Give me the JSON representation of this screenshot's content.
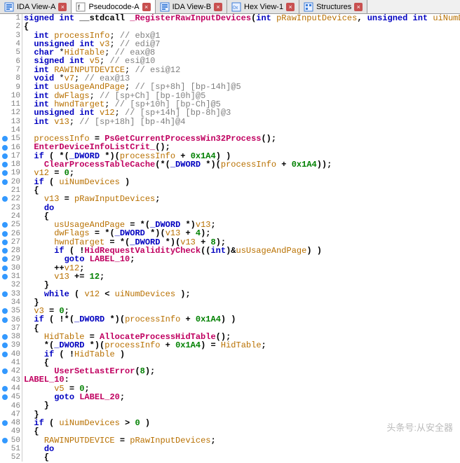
{
  "tabs": [
    {
      "label": "IDA View-A",
      "icon": "ida-icon"
    },
    {
      "label": "Pseudocode-A",
      "icon": "pseudo-icon"
    },
    {
      "label": "IDA View-B",
      "icon": "ida-icon"
    },
    {
      "label": "Hex View-1",
      "icon": "hex-icon"
    },
    {
      "label": "Structures",
      "icon": "struct-icon"
    }
  ],
  "active_tab": 1,
  "watermark": "头条号:从安全器",
  "lines": [
    {
      "n": 1,
      "bp": false,
      "tokens": [
        {
          "t": "signed",
          "c": "kw"
        },
        {
          "t": " "
        },
        {
          "t": "int",
          "c": "kw"
        },
        {
          "t": " __stdcall ",
          "c": "bld"
        },
        {
          "t": "_RegisterRawInputDevices",
          "c": "fn"
        },
        {
          "t": "(",
          "c": "bld"
        },
        {
          "t": "int",
          "c": "kw"
        },
        {
          "t": " "
        },
        {
          "t": "pRawInputDevices",
          "c": "var"
        },
        {
          "t": ", ",
          "c": "bld"
        },
        {
          "t": "unsigned",
          "c": "kw"
        },
        {
          "t": " "
        },
        {
          "t": "int",
          "c": "kw"
        },
        {
          "t": " "
        },
        {
          "t": "uiNumDevices",
          "c": "var"
        },
        {
          "t": ")",
          "c": "bld"
        }
      ]
    },
    {
      "n": 2,
      "bp": false,
      "tokens": [
        {
          "t": "{",
          "c": "bld"
        }
      ]
    },
    {
      "n": 3,
      "bp": false,
      "tokens": [
        {
          "t": "  "
        },
        {
          "t": "int",
          "c": "kw"
        },
        {
          "t": " "
        },
        {
          "t": "processInfo",
          "c": "var"
        },
        {
          "t": "; "
        },
        {
          "t": "// ebx@1",
          "c": "cm"
        }
      ]
    },
    {
      "n": 4,
      "bp": false,
      "tokens": [
        {
          "t": "  "
        },
        {
          "t": "unsigned",
          "c": "kw"
        },
        {
          "t": " "
        },
        {
          "t": "int",
          "c": "kw"
        },
        {
          "t": " "
        },
        {
          "t": "v3",
          "c": "var"
        },
        {
          "t": "; "
        },
        {
          "t": "// edi@7",
          "c": "cm"
        }
      ]
    },
    {
      "n": 5,
      "bp": false,
      "tokens": [
        {
          "t": "  "
        },
        {
          "t": "char",
          "c": "kw"
        },
        {
          "t": " *"
        },
        {
          "t": "HidTable",
          "c": "var"
        },
        {
          "t": "; "
        },
        {
          "t": "// eax@8",
          "c": "cm"
        }
      ]
    },
    {
      "n": 6,
      "bp": false,
      "tokens": [
        {
          "t": "  "
        },
        {
          "t": "signed",
          "c": "kw"
        },
        {
          "t": " "
        },
        {
          "t": "int",
          "c": "kw"
        },
        {
          "t": " "
        },
        {
          "t": "v5",
          "c": "var"
        },
        {
          "t": "; "
        },
        {
          "t": "// esi@10",
          "c": "cm"
        }
      ]
    },
    {
      "n": 7,
      "bp": false,
      "tokens": [
        {
          "t": "  "
        },
        {
          "t": "int",
          "c": "kw"
        },
        {
          "t": " "
        },
        {
          "t": "RAWINPUTDEVICE",
          "c": "var"
        },
        {
          "t": "; "
        },
        {
          "t": "// esi@12",
          "c": "cm"
        }
      ]
    },
    {
      "n": 8,
      "bp": false,
      "tokens": [
        {
          "t": "  "
        },
        {
          "t": "void",
          "c": "kw"
        },
        {
          "t": " *"
        },
        {
          "t": "v7",
          "c": "var"
        },
        {
          "t": "; "
        },
        {
          "t": "// eax@13",
          "c": "cm"
        }
      ]
    },
    {
      "n": 9,
      "bp": false,
      "tokens": [
        {
          "t": "  "
        },
        {
          "t": "int",
          "c": "kw"
        },
        {
          "t": " "
        },
        {
          "t": "usUsageAndPage",
          "c": "var"
        },
        {
          "t": "; "
        },
        {
          "t": "// [sp+8h] [bp-14h]@5",
          "c": "cm"
        }
      ]
    },
    {
      "n": 10,
      "bp": false,
      "tokens": [
        {
          "t": "  "
        },
        {
          "t": "int",
          "c": "kw"
        },
        {
          "t": " "
        },
        {
          "t": "dwFlags",
          "c": "var"
        },
        {
          "t": "; "
        },
        {
          "t": "// [sp+Ch] [bp-10h]@5",
          "c": "cm"
        }
      ]
    },
    {
      "n": 11,
      "bp": false,
      "tokens": [
        {
          "t": "  "
        },
        {
          "t": "int",
          "c": "kw"
        },
        {
          "t": " "
        },
        {
          "t": "hwndTarget",
          "c": "var"
        },
        {
          "t": "; "
        },
        {
          "t": "// [sp+10h] [bp-Ch]@5",
          "c": "cm"
        }
      ]
    },
    {
      "n": 12,
      "bp": false,
      "tokens": [
        {
          "t": "  "
        },
        {
          "t": "unsigned",
          "c": "kw"
        },
        {
          "t": " "
        },
        {
          "t": "int",
          "c": "kw"
        },
        {
          "t": " "
        },
        {
          "t": "v12",
          "c": "var"
        },
        {
          "t": "; "
        },
        {
          "t": "// [sp+14h] [bp-8h]@3",
          "c": "cm"
        }
      ]
    },
    {
      "n": 13,
      "bp": false,
      "tokens": [
        {
          "t": "  "
        },
        {
          "t": "int",
          "c": "kw"
        },
        {
          "t": " "
        },
        {
          "t": "v13",
          "c": "var"
        },
        {
          "t": "; "
        },
        {
          "t": "// [sp+18h] [bp-4h]@4",
          "c": "cm"
        }
      ]
    },
    {
      "n": 14,
      "bp": false,
      "tokens": []
    },
    {
      "n": 15,
      "bp": true,
      "tokens": [
        {
          "t": "  "
        },
        {
          "t": "processInfo",
          "c": "var"
        },
        {
          "t": " = ",
          "c": "bld"
        },
        {
          "t": "PsGetCurrentProcessWin32Process",
          "c": "fn"
        },
        {
          "t": "();",
          "c": "bld"
        }
      ]
    },
    {
      "n": 16,
      "bp": true,
      "tokens": [
        {
          "t": "  "
        },
        {
          "t": "EnterDeviceInfoListCrit_",
          "c": "fn"
        },
        {
          "t": "();",
          "c": "bld"
        }
      ]
    },
    {
      "n": 17,
      "bp": true,
      "tokens": [
        {
          "t": "  "
        },
        {
          "t": "if",
          "c": "kw"
        },
        {
          "t": " ( *(",
          "c": "bld"
        },
        {
          "t": "_DWORD",
          "c": "typ"
        },
        {
          "t": " *)(",
          "c": "bld"
        },
        {
          "t": "processInfo",
          "c": "var"
        },
        {
          "t": " + ",
          "c": "bld"
        },
        {
          "t": "0x1A4",
          "c": "num"
        },
        {
          "t": ") )",
          "c": "bld"
        }
      ]
    },
    {
      "n": 18,
      "bp": true,
      "tokens": [
        {
          "t": "    "
        },
        {
          "t": "ClearProcessTableCache",
          "c": "fn"
        },
        {
          "t": "(*(",
          "c": "bld"
        },
        {
          "t": "_DWORD",
          "c": "typ"
        },
        {
          "t": " *)(",
          "c": "bld"
        },
        {
          "t": "processInfo",
          "c": "var"
        },
        {
          "t": " + ",
          "c": "bld"
        },
        {
          "t": "0x1A4",
          "c": "num"
        },
        {
          "t": "));",
          "c": "bld"
        }
      ]
    },
    {
      "n": 19,
      "bp": true,
      "tokens": [
        {
          "t": "  "
        },
        {
          "t": "v12",
          "c": "var"
        },
        {
          "t": " = ",
          "c": "bld"
        },
        {
          "t": "0",
          "c": "num"
        },
        {
          "t": ";",
          "c": "bld"
        }
      ]
    },
    {
      "n": 20,
      "bp": true,
      "tokens": [
        {
          "t": "  "
        },
        {
          "t": "if",
          "c": "kw"
        },
        {
          "t": " ( ",
          "c": "bld"
        },
        {
          "t": "uiNumDevices",
          "c": "var"
        },
        {
          "t": " )",
          "c": "bld"
        }
      ]
    },
    {
      "n": 21,
      "bp": false,
      "tokens": [
        {
          "t": "  {",
          "c": "bld"
        }
      ]
    },
    {
      "n": 22,
      "bp": true,
      "tokens": [
        {
          "t": "    "
        },
        {
          "t": "v13",
          "c": "var"
        },
        {
          "t": " = ",
          "c": "bld"
        },
        {
          "t": "pRawInputDevices",
          "c": "var"
        },
        {
          "t": ";",
          "c": "bld"
        }
      ]
    },
    {
      "n": 23,
      "bp": false,
      "tokens": [
        {
          "t": "    "
        },
        {
          "t": "do",
          "c": "kw"
        }
      ]
    },
    {
      "n": 24,
      "bp": false,
      "tokens": [
        {
          "t": "    {",
          "c": "bld"
        }
      ]
    },
    {
      "n": 25,
      "bp": true,
      "tokens": [
        {
          "t": "      "
        },
        {
          "t": "usUsageAndPage",
          "c": "var"
        },
        {
          "t": " = *(",
          "c": "bld"
        },
        {
          "t": "_DWORD",
          "c": "typ"
        },
        {
          "t": " *)",
          "c": "bld"
        },
        {
          "t": "v13",
          "c": "var"
        },
        {
          "t": ";",
          "c": "bld"
        }
      ]
    },
    {
      "n": 26,
      "bp": true,
      "tokens": [
        {
          "t": "      "
        },
        {
          "t": "dwFlags",
          "c": "var"
        },
        {
          "t": " = *(",
          "c": "bld"
        },
        {
          "t": "_DWORD",
          "c": "typ"
        },
        {
          "t": " *)(",
          "c": "bld"
        },
        {
          "t": "v13",
          "c": "var"
        },
        {
          "t": " + ",
          "c": "bld"
        },
        {
          "t": "4",
          "c": "num"
        },
        {
          "t": ");",
          "c": "bld"
        }
      ]
    },
    {
      "n": 27,
      "bp": true,
      "tokens": [
        {
          "t": "      "
        },
        {
          "t": "hwndTarget",
          "c": "var"
        },
        {
          "t": " = *(",
          "c": "bld"
        },
        {
          "t": "_DWORD",
          "c": "typ"
        },
        {
          "t": " *)(",
          "c": "bld"
        },
        {
          "t": "v13",
          "c": "var"
        },
        {
          "t": " + ",
          "c": "bld"
        },
        {
          "t": "8",
          "c": "num"
        },
        {
          "t": ");",
          "c": "bld"
        }
      ]
    },
    {
      "n": 28,
      "bp": true,
      "tokens": [
        {
          "t": "      "
        },
        {
          "t": "if",
          "c": "kw"
        },
        {
          "t": " ( !",
          "c": "bld"
        },
        {
          "t": "HidRequestValidityCheck",
          "c": "fn"
        },
        {
          "t": "((",
          "c": "bld"
        },
        {
          "t": "int",
          "c": "kw"
        },
        {
          "t": ")&",
          "c": "bld"
        },
        {
          "t": "usUsageAndPage",
          "c": "var"
        },
        {
          "t": ") )",
          "c": "bld"
        }
      ]
    },
    {
      "n": 29,
      "bp": true,
      "tokens": [
        {
          "t": "        "
        },
        {
          "t": "goto",
          "c": "kw"
        },
        {
          "t": " "
        },
        {
          "t": "LABEL_10",
          "c": "fn"
        },
        {
          "t": ";",
          "c": "bld"
        }
      ]
    },
    {
      "n": 30,
      "bp": true,
      "tokens": [
        {
          "t": "      ++",
          "c": "bld"
        },
        {
          "t": "v12",
          "c": "var"
        },
        {
          "t": ";",
          "c": "bld"
        }
      ]
    },
    {
      "n": 31,
      "bp": true,
      "tokens": [
        {
          "t": "      "
        },
        {
          "t": "v13",
          "c": "var"
        },
        {
          "t": " += ",
          "c": "bld"
        },
        {
          "t": "12",
          "c": "num"
        },
        {
          "t": ";",
          "c": "bld"
        }
      ]
    },
    {
      "n": 32,
      "bp": false,
      "tokens": [
        {
          "t": "    }",
          "c": "bld"
        }
      ]
    },
    {
      "n": 33,
      "bp": true,
      "tokens": [
        {
          "t": "    "
        },
        {
          "t": "while",
          "c": "kw"
        },
        {
          "t": " ( ",
          "c": "bld"
        },
        {
          "t": "v12",
          "c": "var"
        },
        {
          "t": " < ",
          "c": "bld"
        },
        {
          "t": "uiNumDevices",
          "c": "var"
        },
        {
          "t": " );",
          "c": "bld"
        }
      ]
    },
    {
      "n": 34,
      "bp": false,
      "tokens": [
        {
          "t": "  }",
          "c": "bld"
        }
      ]
    },
    {
      "n": 35,
      "bp": true,
      "tokens": [
        {
          "t": "  "
        },
        {
          "t": "v3",
          "c": "var"
        },
        {
          "t": " = ",
          "c": "bld"
        },
        {
          "t": "0",
          "c": "num"
        },
        {
          "t": ";",
          "c": "bld"
        }
      ]
    },
    {
      "n": 36,
      "bp": true,
      "tokens": [
        {
          "t": "  "
        },
        {
          "t": "if",
          "c": "kw"
        },
        {
          "t": " ( !*(",
          "c": "bld"
        },
        {
          "t": "_DWORD",
          "c": "typ"
        },
        {
          "t": " *)(",
          "c": "bld"
        },
        {
          "t": "processInfo",
          "c": "var"
        },
        {
          "t": " + ",
          "c": "bld"
        },
        {
          "t": "0x1A4",
          "c": "num"
        },
        {
          "t": ") )",
          "c": "bld"
        }
      ]
    },
    {
      "n": 37,
      "bp": false,
      "tokens": [
        {
          "t": "  {",
          "c": "bld"
        }
      ]
    },
    {
      "n": 38,
      "bp": true,
      "tokens": [
        {
          "t": "    "
        },
        {
          "t": "HidTable",
          "c": "var"
        },
        {
          "t": " = ",
          "c": "bld"
        },
        {
          "t": "AllocateProcessHidTable",
          "c": "fn"
        },
        {
          "t": "();",
          "c": "bld"
        }
      ]
    },
    {
      "n": 39,
      "bp": true,
      "tokens": [
        {
          "t": "    *(",
          "c": "bld"
        },
        {
          "t": "_DWORD",
          "c": "typ"
        },
        {
          "t": " *)(",
          "c": "bld"
        },
        {
          "t": "processInfo",
          "c": "var"
        },
        {
          "t": " + ",
          "c": "bld"
        },
        {
          "t": "0x1A4",
          "c": "num"
        },
        {
          "t": ") = ",
          "c": "bld"
        },
        {
          "t": "HidTable",
          "c": "var"
        },
        {
          "t": ";",
          "c": "bld"
        }
      ]
    },
    {
      "n": 40,
      "bp": true,
      "tokens": [
        {
          "t": "    "
        },
        {
          "t": "if",
          "c": "kw"
        },
        {
          "t": " ( !",
          "c": "bld"
        },
        {
          "t": "HidTable",
          "c": "var"
        },
        {
          "t": " )",
          "c": "bld"
        }
      ]
    },
    {
      "n": 41,
      "bp": false,
      "tokens": [
        {
          "t": "    {",
          "c": "bld"
        }
      ]
    },
    {
      "n": 42,
      "bp": true,
      "tokens": [
        {
          "t": "      "
        },
        {
          "t": "UserSetLastError",
          "c": "fn"
        },
        {
          "t": "(",
          "c": "bld"
        },
        {
          "t": "8",
          "c": "num"
        },
        {
          "t": ");",
          "c": "bld"
        }
      ]
    },
    {
      "n": 43,
      "bp": false,
      "tokens": [
        {
          "t": "LABEL_10",
          "c": "fn"
        },
        {
          "t": ":",
          "c": "bld"
        }
      ]
    },
    {
      "n": 44,
      "bp": true,
      "tokens": [
        {
          "t": "      "
        },
        {
          "t": "v5",
          "c": "var"
        },
        {
          "t": " = ",
          "c": "bld"
        },
        {
          "t": "0",
          "c": "num"
        },
        {
          "t": ";",
          "c": "bld"
        }
      ]
    },
    {
      "n": 45,
      "bp": true,
      "tokens": [
        {
          "t": "      "
        },
        {
          "t": "goto",
          "c": "kw"
        },
        {
          "t": " "
        },
        {
          "t": "LABEL_20",
          "c": "fn"
        },
        {
          "t": ";",
          "c": "bld"
        }
      ]
    },
    {
      "n": 46,
      "bp": false,
      "tokens": [
        {
          "t": "    }",
          "c": "bld"
        }
      ]
    },
    {
      "n": 47,
      "bp": false,
      "tokens": [
        {
          "t": "  }",
          "c": "bld"
        }
      ]
    },
    {
      "n": 48,
      "bp": true,
      "tokens": [
        {
          "t": "  "
        },
        {
          "t": "if",
          "c": "kw"
        },
        {
          "t": " ( ",
          "c": "bld"
        },
        {
          "t": "uiNumDevices",
          "c": "var"
        },
        {
          "t": " > ",
          "c": "bld"
        },
        {
          "t": "0",
          "c": "num"
        },
        {
          "t": " )",
          "c": "bld"
        }
      ]
    },
    {
      "n": 49,
      "bp": false,
      "tokens": [
        {
          "t": "  {",
          "c": "bld"
        }
      ]
    },
    {
      "n": 50,
      "bp": true,
      "tokens": [
        {
          "t": "    "
        },
        {
          "t": "RAWINPUTDEVICE",
          "c": "var"
        },
        {
          "t": " = ",
          "c": "bld"
        },
        {
          "t": "pRawInputDevices",
          "c": "var"
        },
        {
          "t": ";",
          "c": "bld"
        }
      ]
    },
    {
      "n": 51,
      "bp": false,
      "tokens": [
        {
          "t": "    "
        },
        {
          "t": "do",
          "c": "kw"
        }
      ]
    },
    {
      "n": 52,
      "bp": false,
      "tokens": [
        {
          "t": "    {",
          "c": "bld"
        }
      ]
    }
  ]
}
